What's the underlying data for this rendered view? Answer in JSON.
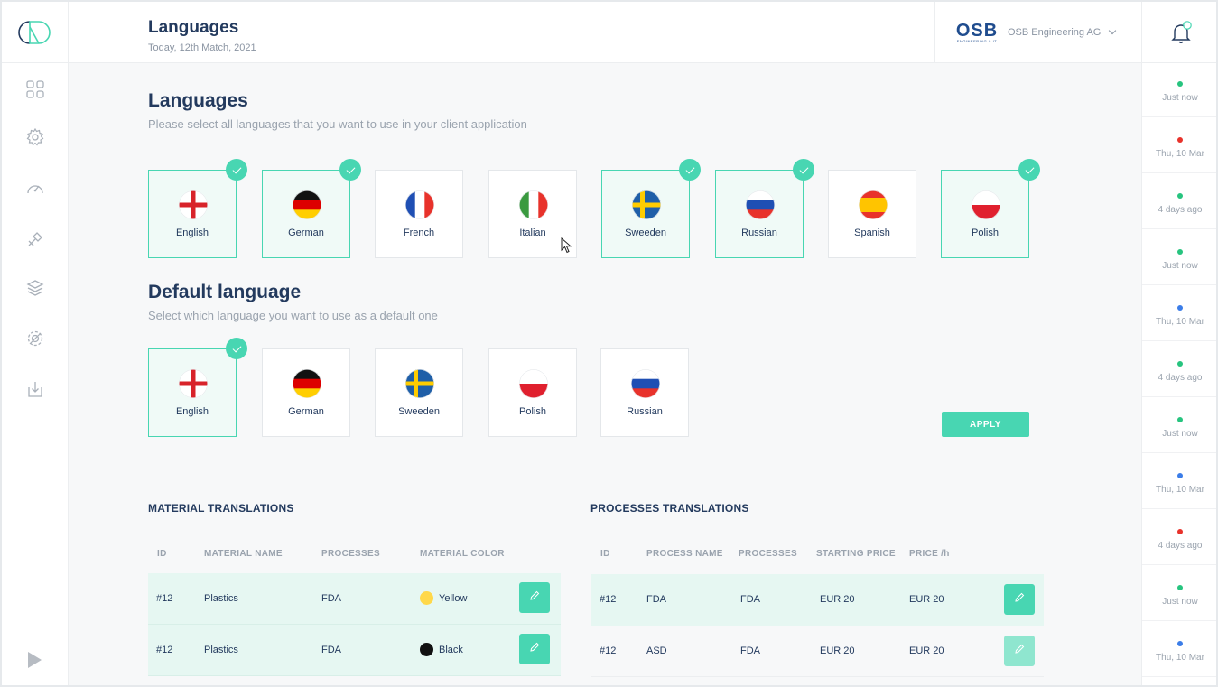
{
  "header": {
    "title": "Languages",
    "date": "Today, 12th Match, 2021",
    "company_logo_text": "OSB",
    "company_logo_subtext": "ENGINEERING & IT",
    "company_name": "OSB Engineering AG",
    "notification_count": "0"
  },
  "sidebar": {
    "items": [
      {
        "icon": "dashboard-grid-icon"
      },
      {
        "icon": "settings-gear-icon"
      },
      {
        "icon": "speedometer-icon"
      },
      {
        "icon": "tools-icon"
      },
      {
        "icon": "layers-icon"
      },
      {
        "icon": "cog-settings-icon"
      },
      {
        "icon": "download-icon"
      }
    ],
    "play_icon": "play-icon"
  },
  "languages": {
    "title": "Languages",
    "subtitle": "Please select all languages that you want to use in your client application",
    "items": [
      {
        "label": "English",
        "selected": true
      },
      {
        "label": "German",
        "selected": true
      },
      {
        "label": "French",
        "selected": false
      },
      {
        "label": "Italian",
        "selected": false
      },
      {
        "label": "Sweeden",
        "selected": true
      },
      {
        "label": "Russian",
        "selected": true
      },
      {
        "label": "Spanish",
        "selected": false
      },
      {
        "label": "Polish",
        "selected": true
      }
    ]
  },
  "default_language": {
    "title": "Default language",
    "subtitle": "Select which language you want to use as a default one",
    "items": [
      {
        "label": "English",
        "selected": true
      },
      {
        "label": "German",
        "selected": false
      },
      {
        "label": "Sweeden",
        "selected": false
      },
      {
        "label": "Polish",
        "selected": false
      },
      {
        "label": "Russian",
        "selected": false
      }
    ],
    "apply_label": "APPLY"
  },
  "material_translations": {
    "title": "MATERIAL TRANSLATIONS",
    "columns": [
      "ID",
      "MATERIAL NAME",
      "PROCESSES",
      "MATERIAL COLOR"
    ],
    "rows": [
      {
        "id": "#12",
        "name": "Plastics",
        "processes": "FDA",
        "color_label": "Yellow",
        "color": "#ffd84a"
      },
      {
        "id": "#12",
        "name": "Plastics",
        "processes": "FDA",
        "color_label": "Black",
        "color": "#111111"
      }
    ]
  },
  "processes_translations": {
    "title": "PROCESSES TRANSLATIONS",
    "columns": [
      "ID",
      "PROCESS NAME",
      "PROCESSES",
      "STARTING PRICE",
      "PRICE /h"
    ],
    "rows": [
      {
        "id": "#12",
        "name": "FDA",
        "processes": "FDA",
        "starting_price": "EUR 20",
        "price_h": "EUR 20"
      },
      {
        "id": "#12",
        "name": "ASD",
        "processes": "FDA",
        "starting_price": "EUR 20",
        "price_h": "EUR 20"
      }
    ]
  },
  "notifications": [
    {
      "time": "Just now",
      "color": "#27c47f"
    },
    {
      "time": "Thu, 10 Mar",
      "color": "#e8322b"
    },
    {
      "time": "4 days ago",
      "color": "#27c47f"
    },
    {
      "time": "Just now",
      "color": "#27c47f"
    },
    {
      "time": "Thu, 10 Mar",
      "color": "#3b7de8"
    },
    {
      "time": "4 days ago",
      "color": "#27c47f"
    },
    {
      "time": "Just now",
      "color": "#27c47f"
    },
    {
      "time": "Thu, 10 Mar",
      "color": "#3b7de8"
    },
    {
      "time": "4 days ago",
      "color": "#e8322b"
    },
    {
      "time": "Just now",
      "color": "#27c47f"
    },
    {
      "time": "Thu, 10 Mar",
      "color": "#3b7de8"
    }
  ],
  "colors": {
    "accent": "#48d6b2",
    "text_dark": "#233a5e",
    "text_muted": "#9aa3ae"
  }
}
